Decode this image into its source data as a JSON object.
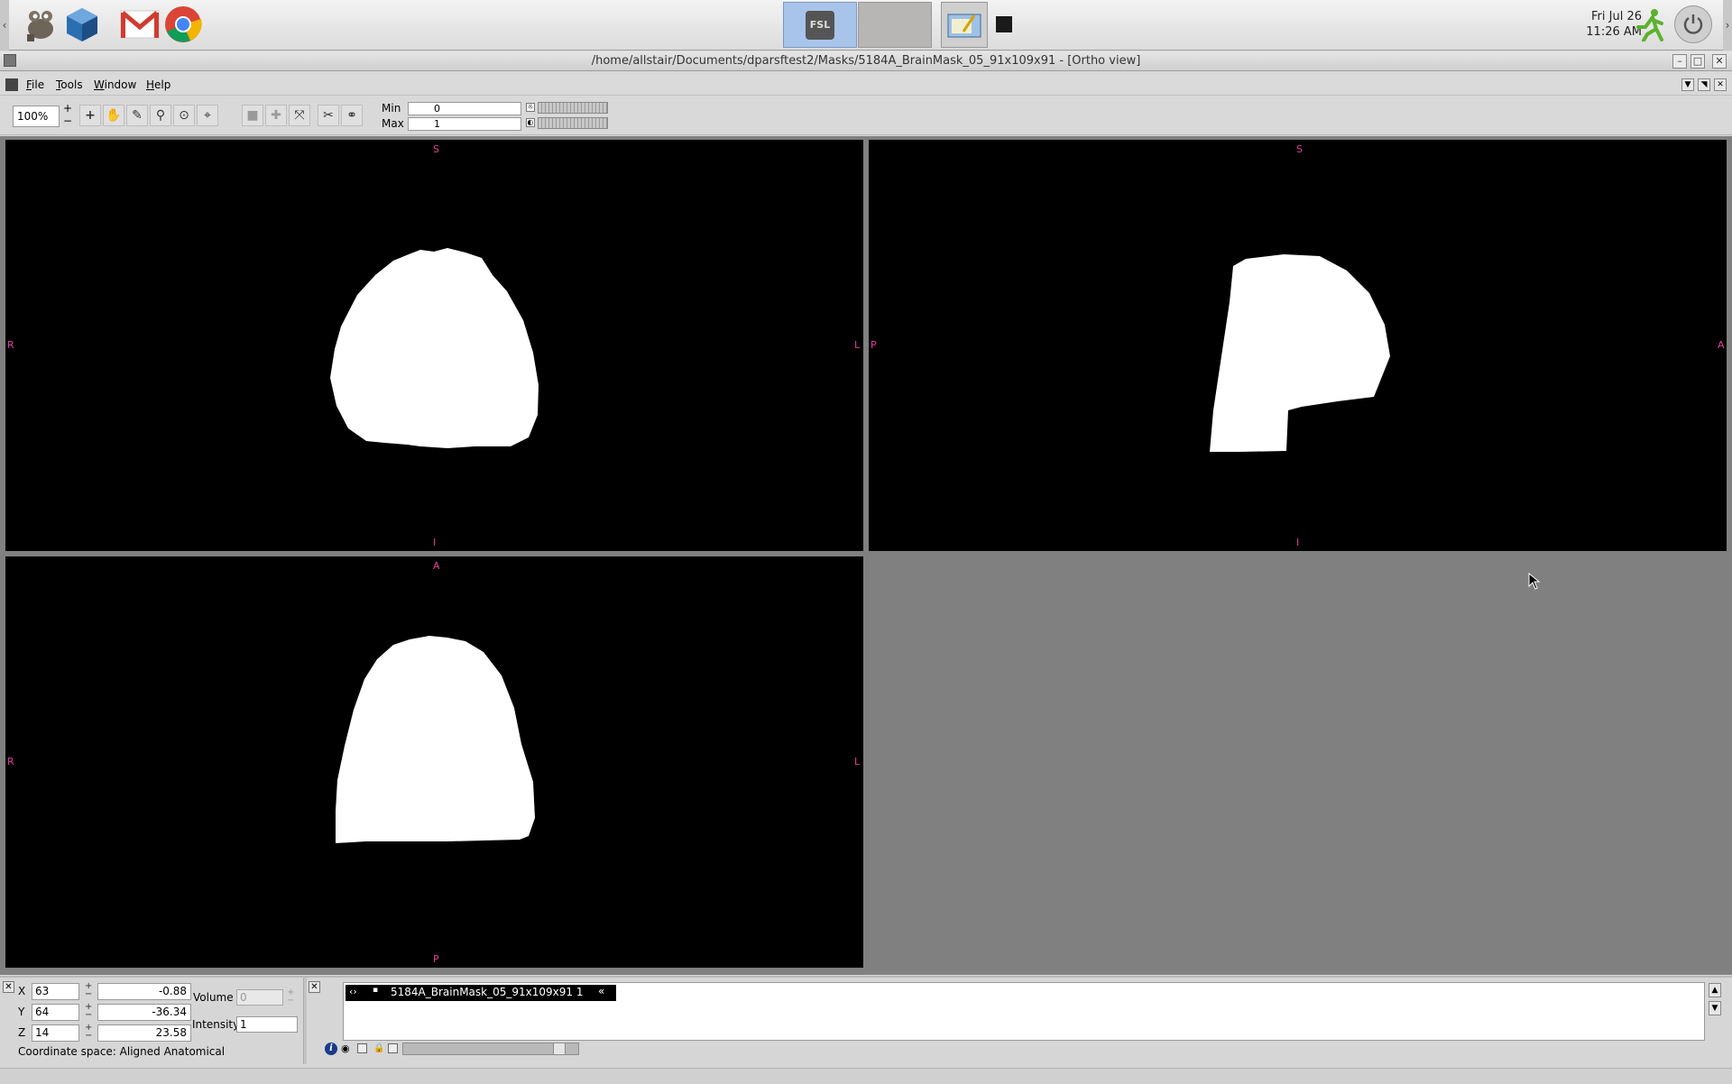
{
  "taskbar": {
    "left_arrow": "‹",
    "right_arrow": "›",
    "launchers": [
      "gimp-icon",
      "virtualbox-icon",
      "gmail-icon",
      "chrome-icon"
    ],
    "tasks": {
      "fsl_label": "FSL"
    },
    "clock": {
      "date": "Fri Jul 26",
      "time": "11:26 AM"
    }
  },
  "window": {
    "title": "/home/allstair/Documents/dparsftest2/Masks/5184A_BrainMask_05_91x109x91 - [Ortho view]",
    "buttons": {
      "minimize": "–",
      "maximize": "□",
      "close": "✕"
    }
  },
  "menubar": {
    "items": [
      {
        "label": "File",
        "key": "F"
      },
      {
        "label": "Tools",
        "key": "T"
      },
      {
        "label": "Window",
        "key": "W"
      },
      {
        "label": "Help",
        "key": "H"
      }
    ]
  },
  "toolbar": {
    "zoom": "100%",
    "plus": "+",
    "minus": "−",
    "min_label": "Min",
    "min_value": "0",
    "max_label": "Max",
    "max_value": "1"
  },
  "views": {
    "coronal": {
      "top": "S",
      "bottom": "I",
      "left": "R",
      "right": "L"
    },
    "sagittal": {
      "top": "S",
      "bottom": "I",
      "left": "P",
      "right": "A"
    },
    "axial": {
      "top": "A",
      "bottom": "P",
      "left": "R",
      "right": "L"
    }
  },
  "cursor_panel": {
    "x_label": "X",
    "x_voxel": "63",
    "x_world": "-0.88",
    "y_label": "Y",
    "y_voxel": "64",
    "y_world": "-36.34",
    "z_label": "Z",
    "z_voxel": "14",
    "z_world": "23.58",
    "volume_label": "Volume",
    "volume_value": "0",
    "intensity_label": "Intensity",
    "intensity_value": "1",
    "coordinate_space": "Coordinate space: Aligned Anatomical"
  },
  "layers": {
    "items": [
      {
        "name": "5184A_BrainMask_05_91x109x91 1"
      }
    ]
  },
  "colors": {
    "orientation_label": "#e0409a",
    "view_background": "#000000",
    "mask": "#ffffff",
    "workspace": "#808080"
  }
}
